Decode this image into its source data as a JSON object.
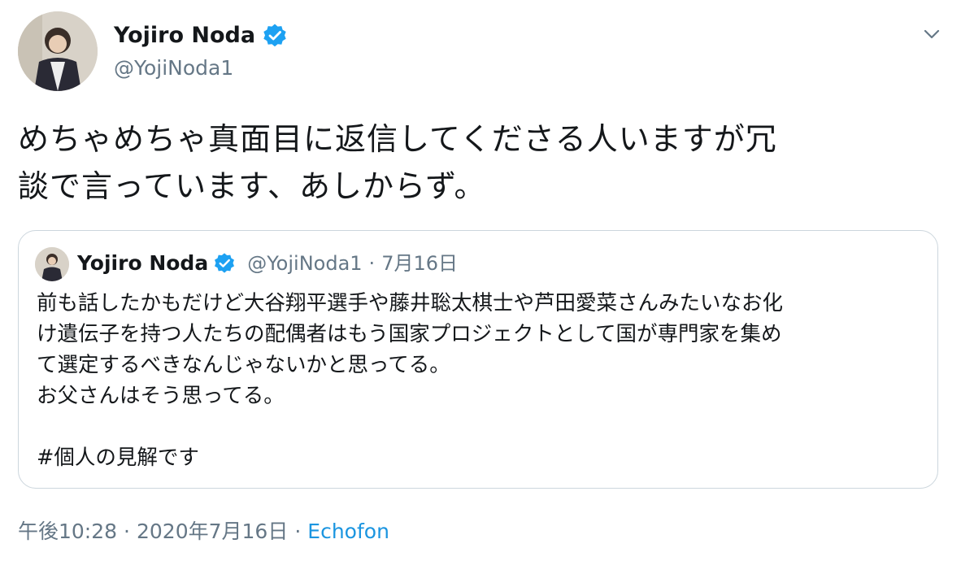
{
  "tweet": {
    "author": {
      "name": "Yojiro Noda",
      "handle": "@YojiNoda1",
      "verified": true
    },
    "text": "めちゃめちゃ真面目に返信してくださる人いますが冗\n談で言っています、あしからず。",
    "quoted": {
      "author_name": "Yojiro Noda",
      "handle": "@YojiNoda1",
      "separator": "·",
      "date": "7月16日",
      "text": "前も話したかもだけど大谷翔平選手や藤井聡太棋士や芦田愛菜さんみたいなお化\nけ遺伝子を持つ人たちの配偶者はもう国家プロジェクトとして国が専門家を集め\nて選定するべきなんじゃないかと思ってる。\nお父さんはそう思ってる。\n\n#個人の見解です"
    },
    "footer": {
      "time": "午後10:28",
      "sep1": "·",
      "date": "2020年7月16日",
      "sep2": "·",
      "source": "Echofon"
    }
  },
  "colors": {
    "text": "#14171a",
    "secondary": "#657786",
    "link": "#1b95e0",
    "verified": "#1da1f2",
    "border": "#ccd6dd"
  },
  "icons": {
    "verified": "verified-badge-icon",
    "menu": "chevron-down-icon"
  }
}
